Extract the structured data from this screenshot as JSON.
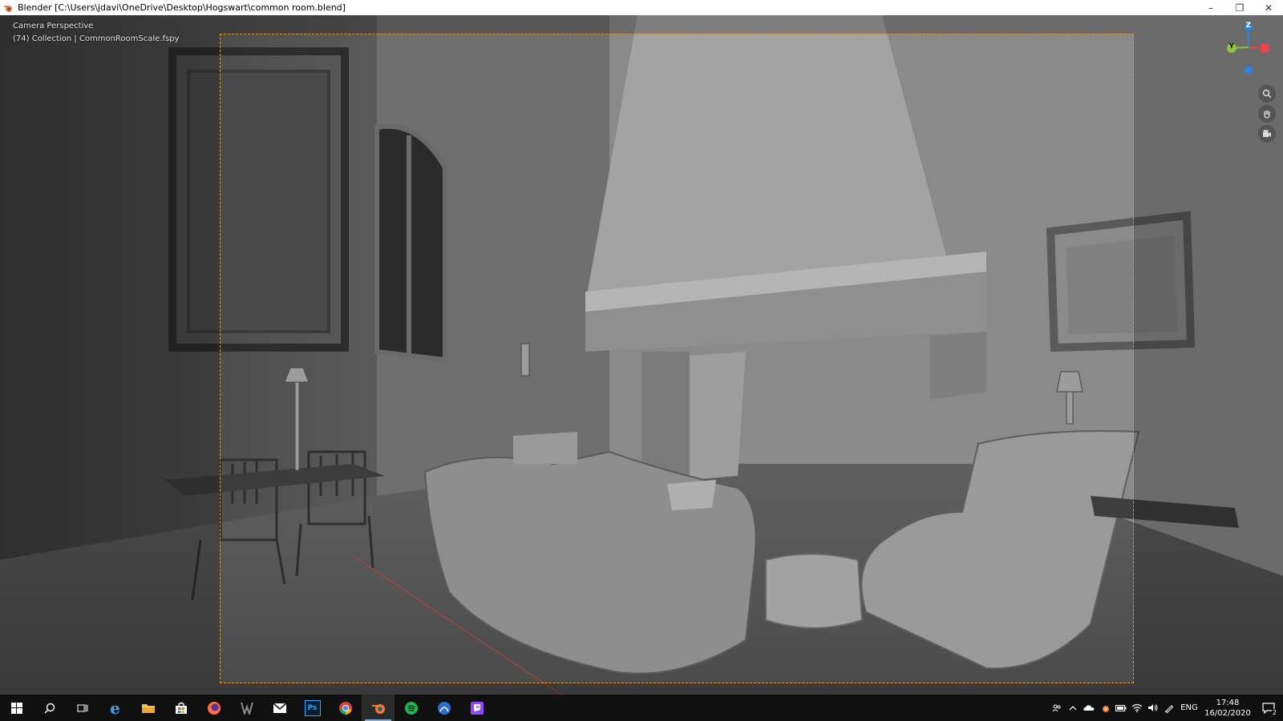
{
  "window": {
    "title": "Blender [C:\\Users\\jdavi\\OneDrive\\Desktop\\Hogswart\\common room.blend]",
    "controls": {
      "minimize": "–",
      "restore": "❐",
      "close": "✕"
    }
  },
  "viewport": {
    "mode_label": "Camera Perspective",
    "collection_label": "(74) Collection | CommonRoomScale.fspy",
    "gizmo": {
      "z": "Z",
      "y": "Y"
    },
    "colors": {
      "frame": "#d8962a",
      "x_axis": "#e8464b",
      "y_axis": "#8bc53f",
      "z_axis": "#2f83e0"
    },
    "nav_icons": [
      "zoom-icon",
      "hand-pan-icon",
      "camera-view-icon"
    ]
  },
  "taskbar": {
    "apps": [
      {
        "name": "start-button",
        "icon": "windows-icon"
      },
      {
        "name": "search-button",
        "icon": "search-icon"
      },
      {
        "name": "task-view-button",
        "icon": "task-view-icon"
      },
      {
        "name": "edge-app",
        "icon": "edge-icon"
      },
      {
        "name": "file-explorer-app",
        "icon": "folder-icon"
      },
      {
        "name": "store-app",
        "icon": "store-icon"
      },
      {
        "name": "firefox-app",
        "icon": "firefox-icon"
      },
      {
        "name": "predator-app",
        "icon": "predator-icon"
      },
      {
        "name": "mail-app",
        "icon": "mail-icon"
      },
      {
        "name": "photoshop-app",
        "icon": "photoshop-icon",
        "text": "Ps"
      },
      {
        "name": "chrome-app",
        "icon": "chrome-icon"
      },
      {
        "name": "blender-app",
        "icon": "blender-icon",
        "active": true
      },
      {
        "name": "spotify-app",
        "icon": "spotify-icon"
      },
      {
        "name": "ps-remote-app",
        "icon": "remote-icon"
      },
      {
        "name": "twitch-app",
        "icon": "twitch-icon"
      }
    ],
    "tray": {
      "language": "ENG",
      "time": "17:48",
      "date": "16/02/2020",
      "notifications": "2"
    }
  }
}
